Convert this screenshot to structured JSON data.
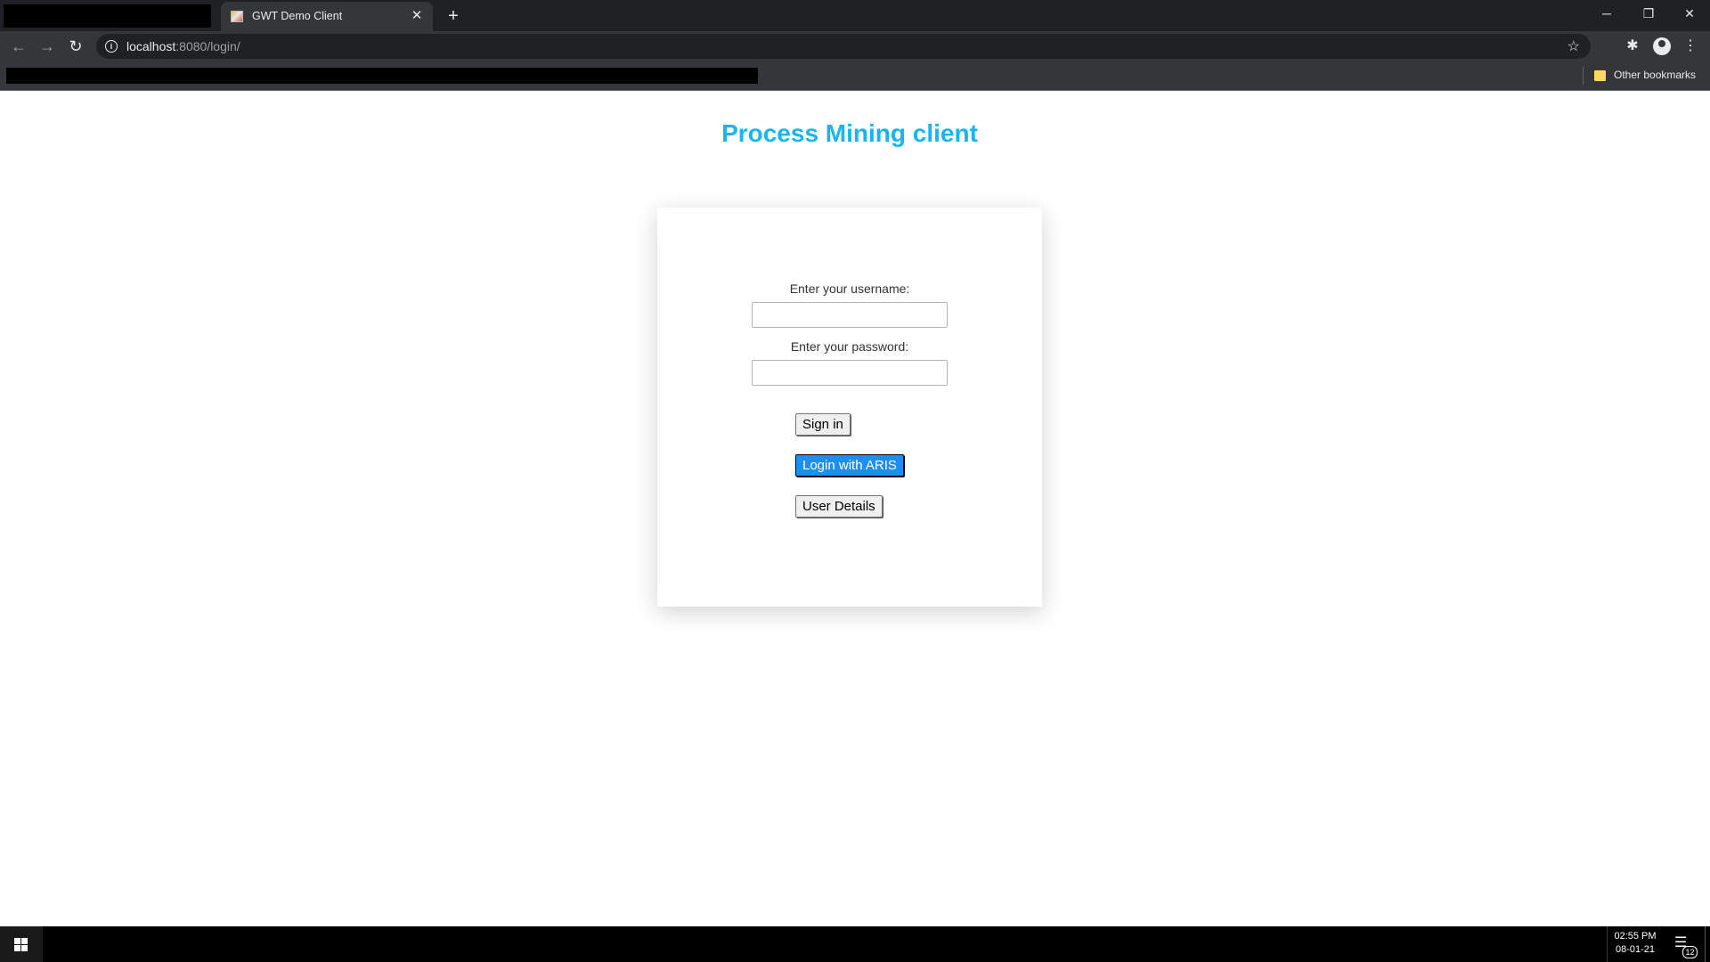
{
  "browser": {
    "tab_title": "GWT Demo Client",
    "tab_close": "✕",
    "new_tab": "+",
    "url_host": "localhost",
    "url_rest": ":8080/login/",
    "bookmarks_label": "Other bookmarks",
    "window_controls": {
      "minimize": "─",
      "restore": "❐",
      "close": "✕"
    }
  },
  "page": {
    "title": "Process Mining client",
    "username_label": "Enter your username:",
    "username_value": "",
    "password_label": "Enter your password:",
    "password_value": "",
    "signin_button": "Sign in",
    "aris_button": "Login with ARIS",
    "details_button": "User Details"
  },
  "taskbar": {
    "time": "02:55 PM",
    "date": "08-01-21",
    "notification_count": "12"
  },
  "colors": {
    "title": "#1ab4f0",
    "primary_button": "#1e8ef0"
  }
}
